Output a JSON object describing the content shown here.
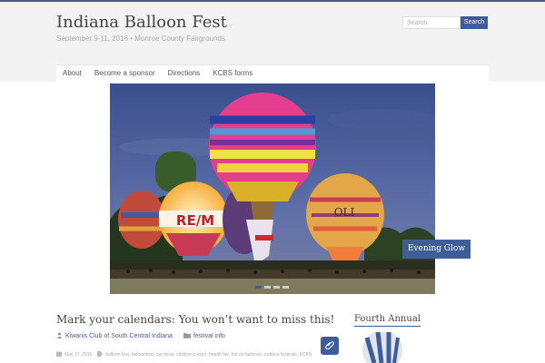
{
  "header": {
    "site_title": "Indiana Balloon Fest",
    "tagline": "September 9-11, 2016 • Monroe County Fairgrounds"
  },
  "search": {
    "placeholder": "Search",
    "button_label": "Search"
  },
  "nav": {
    "items": [
      "About",
      "Become a sponsor",
      "Directions",
      "KCBS forms"
    ]
  },
  "slider": {
    "caption": "Evening Glow",
    "slide_count": 4,
    "active_slide": 1,
    "balloon_text_1": "RE/M",
    "balloon_text_2": "OLI"
  },
  "post": {
    "title": "Mark your calendars: You won’t want to miss this!",
    "author": "Kiwanis Club of South Central Indiana",
    "category": "festival info",
    "date": "May 17, 2016",
    "tags": "balloon fest, balloonfest, car show, children's expo, health fair, hot air balloons, indiana festivals, KCBS"
  },
  "sidebar": {
    "widget_title": "Fourth Annual"
  },
  "colors": {
    "accent": "#3f5e99",
    "background": "#f3f3f3"
  }
}
